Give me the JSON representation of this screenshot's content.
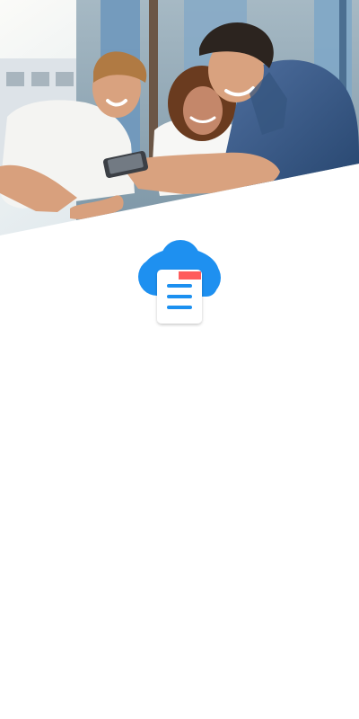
{
  "app": {
    "screen": "splash"
  },
  "hero": {
    "image_description": "",
    "colors": {
      "sky": "#dfe9ee",
      "wall": "#9eb2bd",
      "window_blue": "#5f8fb4",
      "shirt_white": "#f4f4f2",
      "shirt_blue": "#3f5f8d",
      "skin": "#d9a27f",
      "hair_dark": "#2c241f",
      "hair_light": "#b07a43",
      "curly_hair": "#6a3b1f",
      "phone": "#3b3f45"
    }
  },
  "logo": {
    "icon_name": "cloud-document-icon",
    "colors": {
      "cloud": "#1e90f0",
      "document": "#ffffff",
      "document_lines": "#1e90f0",
      "document_tab": "#ff5c5c"
    }
  }
}
